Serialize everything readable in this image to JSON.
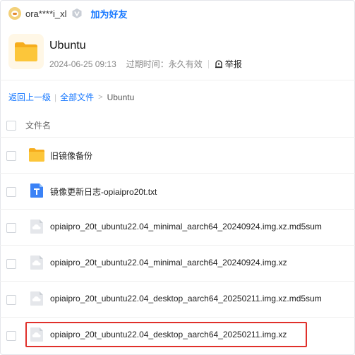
{
  "user": {
    "name": "ora****i_xl",
    "badge_icon": "vip-badge-icon",
    "add_friend": "加为好友"
  },
  "folder": {
    "title": "Ubuntu",
    "date": "2024-06-25 09:13",
    "expire_label": "过期时间：永久有效",
    "report_label": "举报"
  },
  "breadcrumb": {
    "back": "返回上一级",
    "all_files": "全部文件",
    "current": "Ubuntu"
  },
  "list": {
    "column_name": "文件名",
    "items": [
      {
        "name": "旧镜像备份",
        "icon": "folder-icon"
      },
      {
        "name": "镜像更新日志-opiaipro20t.txt",
        "icon": "text-file-icon"
      },
      {
        "name": "opiaipro_20t_ubuntu22.04_minimal_aarch64_20240924.img.xz.md5sum",
        "icon": "cloud-file-icon"
      },
      {
        "name": "opiaipro_20t_ubuntu22.04_minimal_aarch64_20240924.img.xz",
        "icon": "cloud-file-icon"
      },
      {
        "name": "opiaipro_20t_ubuntu22.04_desktop_aarch64_20250211.img.xz.md5sum",
        "icon": "cloud-file-icon"
      },
      {
        "name": "opiaipro_20t_ubuntu22.04_desktop_aarch64_20250211.img.xz",
        "icon": "cloud-file-icon"
      }
    ]
  },
  "colors": {
    "accent": "#1677ff",
    "folder": "#f9bd2a",
    "highlight": "#e0302b",
    "text_icon": "#3b82f6"
  }
}
